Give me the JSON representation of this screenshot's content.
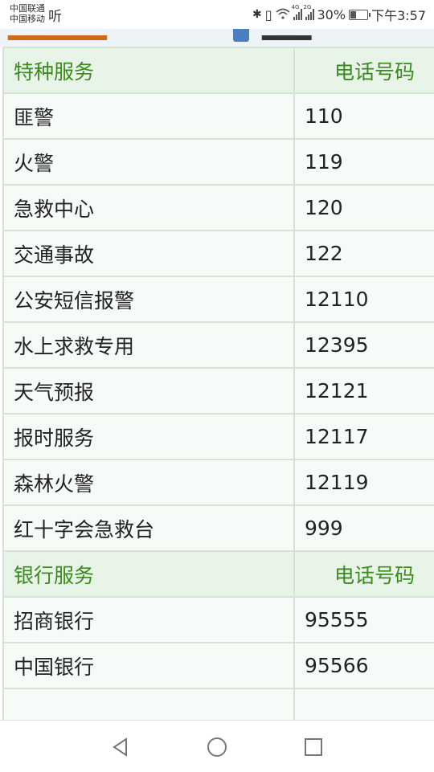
{
  "status_bar": {
    "carrier1": "中国联通",
    "carrier2": "中国移动",
    "listen_label": "听",
    "sig1_tag": "4G",
    "sig2_tag": "2G",
    "battery_percent": "30%",
    "time": "下午3:57",
    "battery_level": 0.3
  },
  "tables": [
    {
      "header": {
        "service": "特种服务",
        "phone": "电话号码"
      },
      "rows": [
        {
          "service": "匪警",
          "phone": "110"
        },
        {
          "service": "火警",
          "phone": "119"
        },
        {
          "service": "急救中心",
          "phone": "120"
        },
        {
          "service": "交通事故",
          "phone": "122"
        },
        {
          "service": "公安短信报警",
          "phone": "12110"
        },
        {
          "service": "水上求救专用",
          "phone": "12395"
        },
        {
          "service": "天气预报",
          "phone": "12121"
        },
        {
          "service": "报时服务",
          "phone": "12117"
        },
        {
          "service": "森林火警",
          "phone": "12119"
        },
        {
          "service": "红十字会急救台",
          "phone": "999"
        }
      ]
    },
    {
      "header": {
        "service": "银行服务",
        "phone": "电话号码"
      },
      "rows": [
        {
          "service": "招商银行",
          "phone": "95555"
        },
        {
          "service": "中国银行",
          "phone": "95566"
        },
        {
          "service": "",
          "phone": ""
        }
      ]
    }
  ],
  "colors": {
    "header_text": "#3a8a1e",
    "header_bg": "#e8f4e8",
    "border": "#d4e4d4"
  }
}
